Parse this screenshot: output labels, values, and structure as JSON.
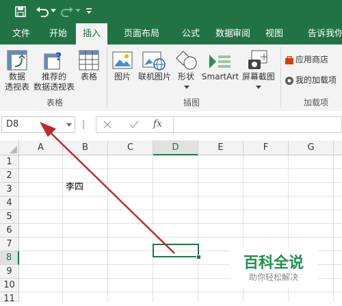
{
  "ribbon_tabs": [
    "文件",
    "开始",
    "插入",
    "页面布局",
    "公式",
    "数据",
    "审阅",
    "视图",
    "告诉我你"
  ],
  "active_tab": "插入",
  "ribbon": {
    "pivot_label_1": "数据",
    "pivot_label_2": "透视表",
    "rec_pivot_label_1": "推荐的",
    "rec_pivot_label_2": "数据透视表",
    "table_label": "表格",
    "group_tables": "表格",
    "picture_label": "图片",
    "online_picture_label": "联机图片",
    "shapes_label": "形状",
    "smartart_label": "SmartArt",
    "screenshot_label": "屏幕截图",
    "group_illustrations": "插图",
    "store_label": "应用商店",
    "my_addins_label": "我的加载项",
    "group_addins": "加载项"
  },
  "formula_bar": {
    "name_box": "D8",
    "fx": "fx",
    "value": ""
  },
  "columns": [
    "A",
    "B",
    "C",
    "D",
    "E",
    "F",
    "G"
  ],
  "rows": [
    "1",
    "2",
    "3",
    "4",
    "5",
    "6",
    "7",
    "8",
    "9",
    "10",
    "11"
  ],
  "cells": {
    "B3": "李四"
  },
  "selected_cell": "D8",
  "watermark": {
    "title": "百科全说",
    "subtitle": "助你轻松解决"
  },
  "colors": {
    "excel_green": "#217346",
    "arrow_red": "#c0282c"
  }
}
